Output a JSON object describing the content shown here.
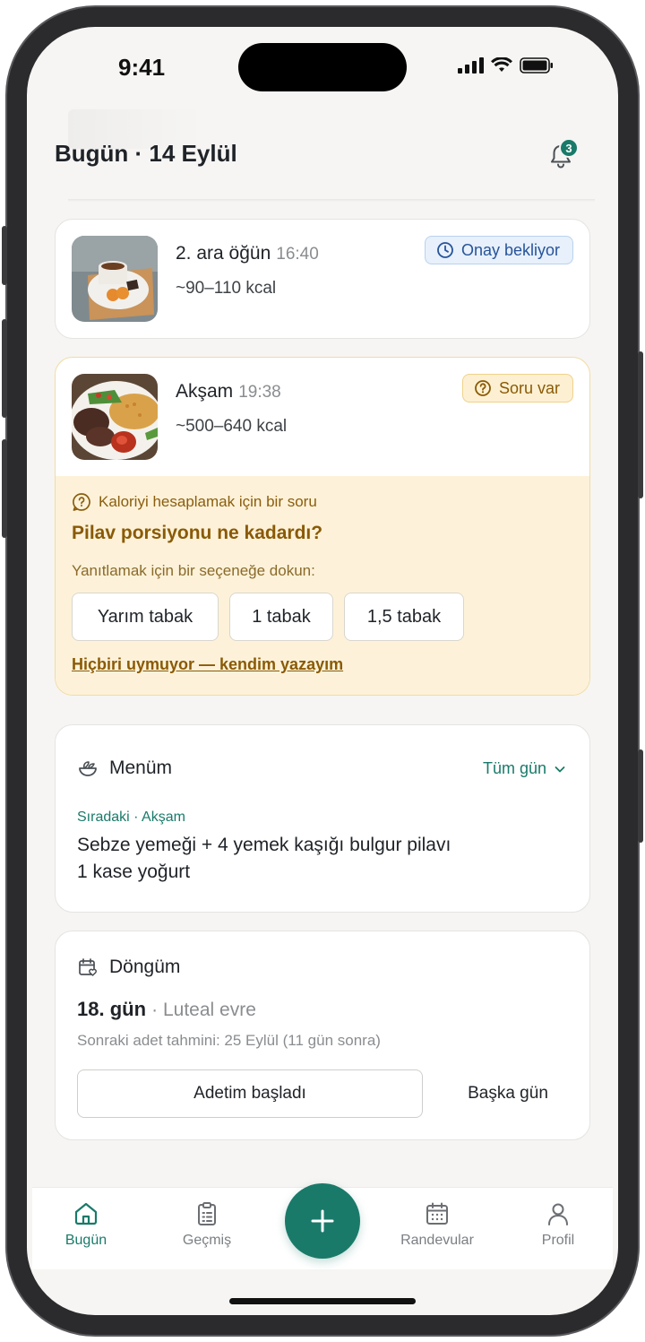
{
  "status_bar": {
    "time": "9:41"
  },
  "header": {
    "title": "Bugün · 14 Eylül",
    "notification_count": "3"
  },
  "meals": [
    {
      "name": "2. ara öğün",
      "time": "16:40",
      "kcal": "~90–110 kcal",
      "status": "Onay bekliyor",
      "status_icon": "clock-icon"
    },
    {
      "name": "Akşam",
      "time": "19:38",
      "kcal": "~500–640 kcal",
      "status": "Soru var",
      "status_icon": "question-circle-icon"
    }
  ],
  "question": {
    "hint": "Kaloriyi hesaplamak için bir soru",
    "title": "Pilav porsiyonu ne kadardı?",
    "instruction": "Yanıtlamak için bir seçeneğe dokun:",
    "options": [
      "Yarım tabak",
      "1 tabak",
      "1,5 tabak"
    ],
    "custom_link": "Hiçbiri uymuyor — kendim yazayım"
  },
  "menu": {
    "title": "Menüm",
    "filter": "Tüm gün",
    "next_label": "Sıradaki · Akşam",
    "lines": [
      "Sebze yemeği + 4 yemek kaşığı bulgur pilavı",
      "1 kase yoğurt"
    ]
  },
  "cycle": {
    "title": "Döngüm",
    "day": "18. gün",
    "phase": "· Luteal evre",
    "next_period": "Sonraki adet tahmini: 25 Eylül (11 gün sonra)",
    "primary_button": "Adetim başladı",
    "secondary_button": "Başka gün"
  },
  "tabbar": {
    "items": [
      {
        "label": "Bugün",
        "icon": "home-icon",
        "active": true
      },
      {
        "label": "Geçmiş",
        "icon": "clipboard-icon",
        "active": false
      },
      {
        "label": "Randevular",
        "icon": "calendar-icon",
        "active": false
      },
      {
        "label": "Profil",
        "icon": "user-icon",
        "active": false
      }
    ],
    "fab_icon": "plus-icon"
  },
  "colors": {
    "accent": "#1a7a6a",
    "amber_bg": "#fdf2d9",
    "amber_text": "#8a5a06",
    "blue_pill": "#27549a"
  }
}
